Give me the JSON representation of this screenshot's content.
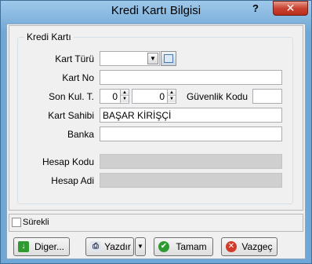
{
  "window": {
    "title": "Kredi Kartı Bilgisi",
    "help_glyph": "?",
    "close_glyph": "✕"
  },
  "group": {
    "legend": "Kredi Kartı"
  },
  "form": {
    "kart_turu_label": "Kart Türü",
    "kart_turu_value": "",
    "kart_no_label": "Kart No",
    "kart_no_value": "",
    "son_kul_label": "Son Kul. T.",
    "son_kul_month": "0",
    "son_kul_year": "0",
    "guvenlik_label": "Güvenlik Kodu",
    "guvenlik_value": "",
    "kart_sahibi_label": "Kart Sahibi",
    "kart_sahibi_value": "BAŞAR KİRİŞÇİ",
    "banka_label": "Banka",
    "banka_value": "",
    "hesap_kodu_label": "Hesap Kodu",
    "hesap_kodu_value": "",
    "hesap_adi_label": "Hesap Adi",
    "hesap_adi_value": ""
  },
  "options": {
    "surekli_label": "Sürekli",
    "surekli_checked": false
  },
  "buttons": {
    "diger": "Diger...",
    "yazdir": "Yazdır",
    "tamam": "Tamam",
    "vazgec": "Vazgeç"
  },
  "icons": {
    "diger": "arrow-down-icon",
    "yazdir": "printer-icon",
    "tamam": "checkmark-icon",
    "vazgec": "cancel-icon"
  },
  "colors": {
    "title_bar": "#6fa8d6",
    "close": "#c94331",
    "ok_green": "#2f9a2f",
    "cancel_red": "#d23a2a"
  }
}
